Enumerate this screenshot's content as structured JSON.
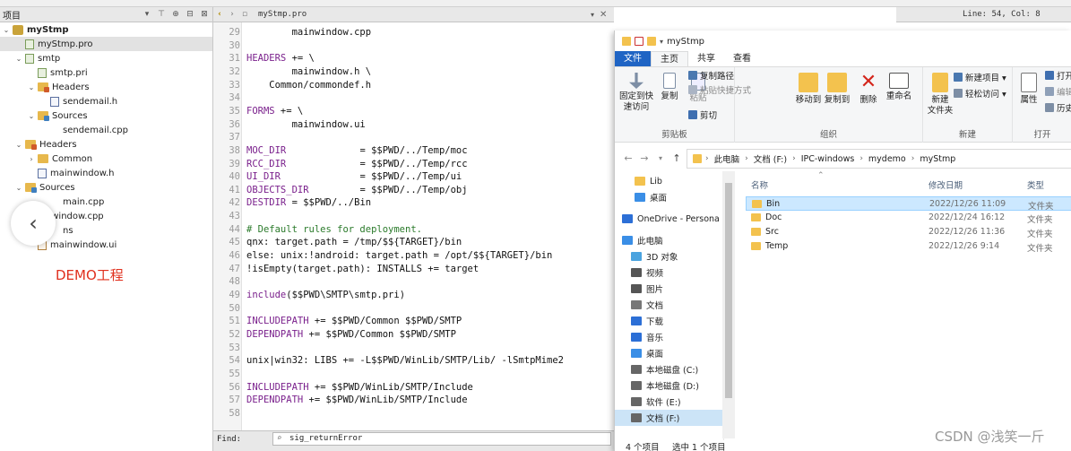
{
  "topbar": {
    "status": "Line: 54, Col: 8"
  },
  "project": {
    "header": "项目",
    "filter_icon": "filter-icon",
    "link_icon": "link-icon",
    "split_icon": "split-icon",
    "close_icon": "close-pane-icon",
    "tree": [
      {
        "label": "myStmp",
        "kind": "pro-root",
        "arrow": "⌄",
        "bold": true
      },
      {
        "label": "myStmp.pro",
        "kind": "pro",
        "arrow": "",
        "selected": true
      },
      {
        "label": "smtp",
        "kind": "pro",
        "arrow": "⌄"
      },
      {
        "label": "smtp.pri",
        "kind": "pro",
        "arrow": ""
      },
      {
        "label": "Headers",
        "kind": "fold h",
        "arrow": "⌄"
      },
      {
        "label": "sendemail.h",
        "kind": "h",
        "arrow": ""
      },
      {
        "label": "Sources",
        "kind": "fold src",
        "arrow": "⌄"
      },
      {
        "label": "sendemail.cpp",
        "kind": "none",
        "arrow": ""
      },
      {
        "label": "Headers",
        "kind": "fold h",
        "arrow": "⌄"
      },
      {
        "label": "Common",
        "kind": "fold",
        "arrow": "›"
      },
      {
        "label": "mainwindow.h",
        "kind": "h",
        "arrow": ""
      },
      {
        "label": "Sources",
        "kind": "fold src",
        "arrow": "⌄"
      },
      {
        "label": "main.cpp",
        "kind": "none",
        "arrow": ""
      },
      {
        "label": "ainwindow.cpp",
        "kind": "none",
        "arrow": ""
      },
      {
        "label": "ns",
        "kind": "none",
        "arrow": ""
      },
      {
        "label": "mainwindow.ui",
        "kind": "ui",
        "arrow": ""
      }
    ],
    "back_icon": "chevron-left-icon",
    "demo_label": "DEMO工程"
  },
  "editor": {
    "filename": "myStmp.pro",
    "close": "✕",
    "find_label": "Find:",
    "find_value": "sig_returnError",
    "lines": [
      {
        "n": "29",
        "code": "        mainwindow.cpp"
      },
      {
        "n": "30",
        "code": ""
      },
      {
        "n": "31",
        "kw": "HEADERS",
        "code": " += \\"
      },
      {
        "n": "32",
        "code": "        mainwindow.h \\"
      },
      {
        "n": "33",
        "code": "    Common/commondef.h"
      },
      {
        "n": "34",
        "code": ""
      },
      {
        "n": "35",
        "kw": "FORMS",
        "code": " += \\"
      },
      {
        "n": "36",
        "code": "        mainwindow.ui"
      },
      {
        "n": "37",
        "code": ""
      },
      {
        "n": "38",
        "kw": "MOC_DIR",
        "code": "             = $$PWD/../Temp/moc"
      },
      {
        "n": "39",
        "kw": "RCC_DIR",
        "code": "             = $$PWD/../Temp/rcc"
      },
      {
        "n": "40",
        "kw": "UI_DIR",
        "code": "              = $$PWD/../Temp/ui"
      },
      {
        "n": "41",
        "kw": "OBJECTS_DIR",
        "code": "         = $$PWD/../Temp/obj"
      },
      {
        "n": "42",
        "kw": "DESTDIR",
        "code": " = $$PWD/../Bin"
      },
      {
        "n": "43",
        "code": ""
      },
      {
        "n": "44",
        "cm": "# Default rules for deployment."
      },
      {
        "n": "45",
        "code": "qnx: target.path = /tmp/$${TARGET}/bin"
      },
      {
        "n": "46",
        "code": "else: unix:!android: target.path = /opt/$${TARGET}/bin"
      },
      {
        "n": "47",
        "code": "!isEmpty(target.path): INSTALLS += target"
      },
      {
        "n": "48",
        "code": ""
      },
      {
        "n": "49",
        "kw": "include",
        "code": "($$PWD\\SMTP\\smtp.pri)"
      },
      {
        "n": "50",
        "code": ""
      },
      {
        "n": "51",
        "kw": "INCLUDEPATH",
        "code": " += $$PWD/Common $$PWD/SMTP"
      },
      {
        "n": "52",
        "kw": "DEPENDPATH",
        "code": " += $$PWD/Common $$PWD/SMTP"
      },
      {
        "n": "53",
        "code": ""
      },
      {
        "n": "54",
        "code": "unix|win32: LIBS += -L$$PWD/WinLib/SMTP/Lib/ -lSmtpMime2"
      },
      {
        "n": "55",
        "code": ""
      },
      {
        "n": "56",
        "kw": "INCLUDEPATH",
        "code": " += $$PWD/WinLib/SMTP/Include"
      },
      {
        "n": "57",
        "kw": "DEPENDPATH",
        "code": " += $$PWD/WinLib/SMTP/Include"
      },
      {
        "n": "58",
        "code": ""
      }
    ]
  },
  "explorer": {
    "title": "myStmp",
    "tabs": [
      "文件",
      "主页",
      "共享",
      "查看"
    ],
    "ribbon": {
      "pin": "固定到快\n速访问",
      "copy": "复制",
      "paste": "粘贴",
      "copy_path": "复制路径",
      "paste_shortcut": "粘贴快捷方式",
      "cut": "剪切",
      "clipboard": "剪贴板",
      "move_to": "移动到",
      "copy_to": "复制到",
      "delete": "删除",
      "rename": "重命名",
      "organize": "组织",
      "new_folder": "新建\n文件夹",
      "new_item": "新建项目 ▾",
      "easy_access": "轻松访问 ▾",
      "new": "新建",
      "properties": "属性",
      "open": "打开",
      "edit": "编辑",
      "history": "历史",
      "open_group": "打开"
    },
    "breadcrumb": [
      "此电脑",
      "文档 (F:)",
      "IPC-windows",
      "mydemo",
      "myStmp"
    ],
    "nav": [
      {
        "label": "Lib",
        "color": "#f3c24e"
      },
      {
        "label": "桌面",
        "color": "#3a8ee6"
      },
      {
        "label": "OneDrive - Persona",
        "color": "#2c6fd6"
      },
      {
        "label": "此电脑",
        "color": "#3a8ee6"
      },
      {
        "label": "3D 对象",
        "color": "#4aa3df"
      },
      {
        "label": "视频",
        "color": "#555"
      },
      {
        "label": "图片",
        "color": "#555"
      },
      {
        "label": "文档",
        "color": "#777"
      },
      {
        "label": "下载",
        "color": "#2c6fd6"
      },
      {
        "label": "音乐",
        "color": "#2c6fd6"
      },
      {
        "label": "桌面",
        "color": "#3a8ee6"
      },
      {
        "label": "本地磁盘 (C:)",
        "color": "#666"
      },
      {
        "label": "本地磁盘 (D:)",
        "color": "#666"
      },
      {
        "label": "软件 (E:)",
        "color": "#666"
      },
      {
        "label": "文档 (F:)",
        "color": "#666",
        "selected": true
      }
    ],
    "columns": {
      "name": "名称",
      "date": "修改日期",
      "type": "类型"
    },
    "files": [
      {
        "name": "Bin",
        "date": "2022/12/26 11:09",
        "type": "文件夹",
        "selected": true
      },
      {
        "name": "Doc",
        "date": "2022/12/24 16:12",
        "type": "文件夹"
      },
      {
        "name": "Src",
        "date": "2022/12/26 11:36",
        "type": "文件夹"
      },
      {
        "name": "Temp",
        "date": "2022/12/26 9:14",
        "type": "文件夹"
      }
    ],
    "status": {
      "count": "4 个项目",
      "selected": "选中 1 个项目"
    }
  },
  "watermark": "CSDN @浅笑一斤",
  "colors": {
    "accent": "#1f64c4",
    "keyword": "#7a208c",
    "comment": "#2a7a2a",
    "demo": "#e0301e"
  }
}
